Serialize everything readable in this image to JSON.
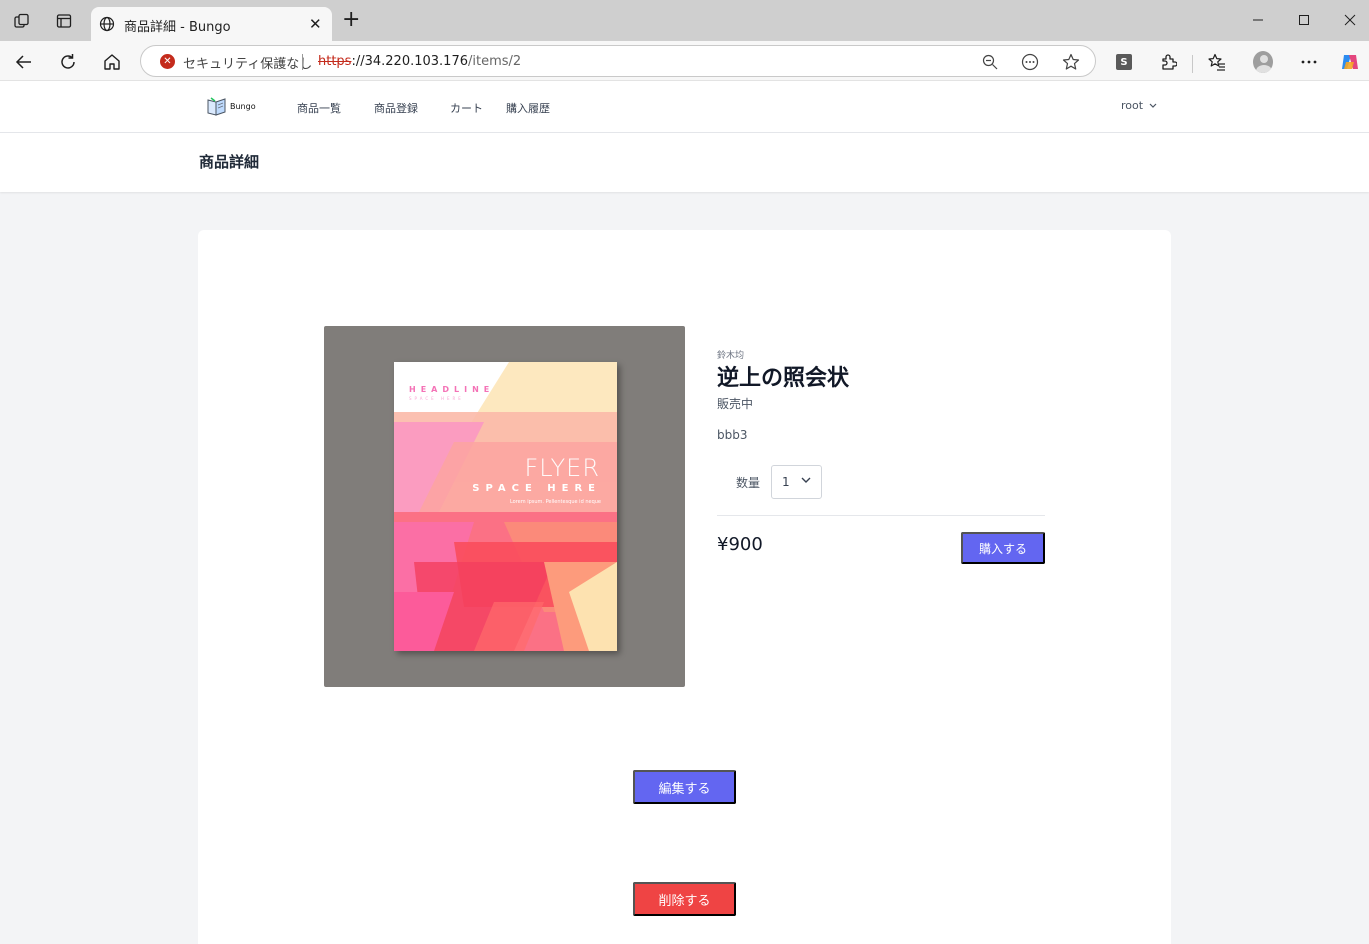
{
  "browser": {
    "tab_title": "商品詳細 - Bungo",
    "security_text": "セキュリティ保護なし",
    "url_scheme": "https",
    "url_host": "://34.220.103.176",
    "url_path": "/items/2"
  },
  "nav": {
    "logo_text": "Bungo",
    "links": [
      "商品一覧",
      "商品登録",
      "カート",
      "購入履歴"
    ],
    "user": "root"
  },
  "page": {
    "title": "商品詳細"
  },
  "product": {
    "flyer": {
      "headline": "HEADLINE",
      "headline_sub": "SPACE HERE",
      "flyer_word": "FLYER",
      "space_here": "SPACE HERE",
      "lorem": "Lorem ipsum. Pellentesque id neque"
    },
    "author": "鈴木均",
    "title": "逆上の照会状",
    "status": "販売中",
    "description": "bbb3",
    "quantity_label": "数量",
    "quantity_value": "1",
    "price": "¥900",
    "buy_label": "購入する"
  },
  "actions": {
    "edit_label": "編集する",
    "delete_label": "削除する"
  },
  "colors": {
    "primary": "#6366f1",
    "danger": "#ef4444",
    "image_bg": "#807d7a"
  }
}
